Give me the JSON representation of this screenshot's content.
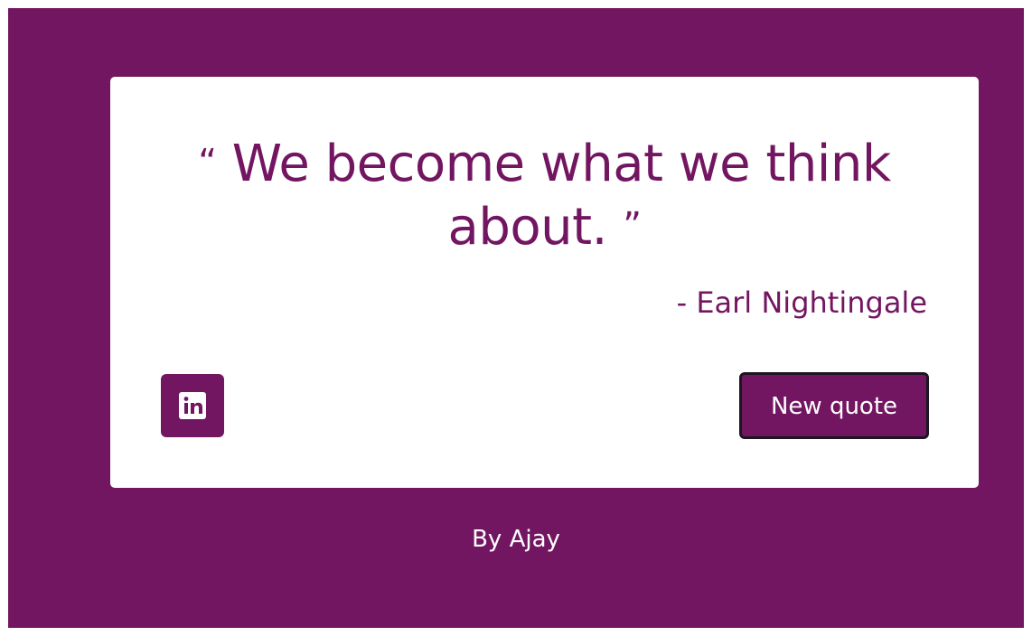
{
  "quote": {
    "open_mark": "“",
    "text": "We become what we think about.",
    "close_mark": "”",
    "author": "- Earl Nightingale"
  },
  "actions": {
    "linkedin_icon": "linkedin-icon",
    "new_quote_label": "New quote"
  },
  "footer": {
    "credit": "By Ajay"
  },
  "colors": {
    "brand": "#731661",
    "card": "#ffffff",
    "button_border": "#1d1520",
    "text_light": "#ffffff"
  }
}
